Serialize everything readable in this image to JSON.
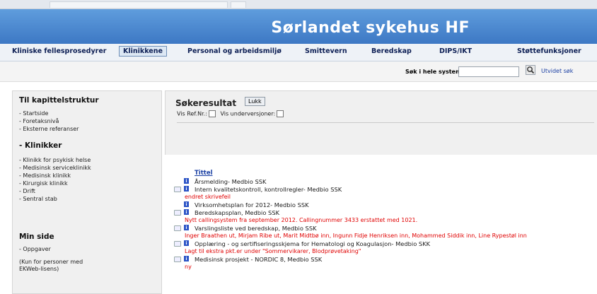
{
  "header": {
    "title": "Sørlandet sykehus HF"
  },
  "nav": [
    "Kliniske fellesprosedyrer",
    "Klinikkene",
    "Personal og arbeidsmiljø",
    "Smittevern",
    "Beredskap",
    "DIPS/IKT",
    "Støttefunksjoner"
  ],
  "nav_active": "Klinikkene",
  "search": {
    "label": "Søk i hele systemet:",
    "value": "",
    "advanced": "Utvidet søk"
  },
  "left": {
    "section1_title": "Til kapittelstruktur",
    "section1_items": [
      "- Startside",
      "- Foretaksnivå",
      "- Eksterne referanser"
    ],
    "section2_title": "- Klinikker",
    "section2_items": [
      "- Klinikk for psykisk helse",
      "- Medisinsk serviceklinikk",
      "- Medisinsk klinikk",
      "- Kirurgisk klinikk",
      "- Drift",
      "- Sentral stab"
    ],
    "section3_title": "Min side",
    "section3_items": [
      "- Oppgaver",
      "(Kun for personer med",
      "EKWeb-lisens)"
    ]
  },
  "content": {
    "title": "Søkeresultat",
    "close": "Lukk",
    "vis_ref": "Vis Ref.Nr.:",
    "vis_under": "Vis underversjoner:"
  },
  "results": {
    "header": "Tittel",
    "items": [
      {
        "title": "Årsmelding- Medbio SSK",
        "expandable": false,
        "note": ""
      },
      {
        "title": "Intern kvalitetskontroll, kontrollregler- Medbio SSK",
        "expandable": true,
        "note": "endret skrivefeil"
      },
      {
        "title": "Virksomhetsplan for 2012- Medbio SSK",
        "expandable": false,
        "note": ""
      },
      {
        "title": "Beredskapsplan, Medbio SSK",
        "expandable": true,
        "note": "Nytt callingsystem fra september 2012. Callingnummer 3433 erstattet med 1021."
      },
      {
        "title": "Varslingsliste ved beredskap, Medbio SSK",
        "expandable": true,
        "note": "Inger Braathen ut, Mirjam Ribe ut, Marit Midtbø inn, Ingunn Fidje Henriksen inn, Mohammed Siddik inn, Line Rypestøl inn"
      },
      {
        "title": "Opplæring - og sertifiseringsskjema for Hematologi og Koagulasjon- Medbio SKK",
        "expandable": true,
        "note": "Lagt til ekstra pkt.er under \"Sommervikarer, Blodprøvetaking\""
      },
      {
        "title": "Medisinsk prosjekt - NORDIC 8, Medbio SSK",
        "expandable": true,
        "note": "ny"
      }
    ]
  },
  "colors": {
    "banner": "#4a86d0",
    "nav_text": "#0d1f55",
    "link": "#1a3fa3",
    "note": "#e00000"
  }
}
